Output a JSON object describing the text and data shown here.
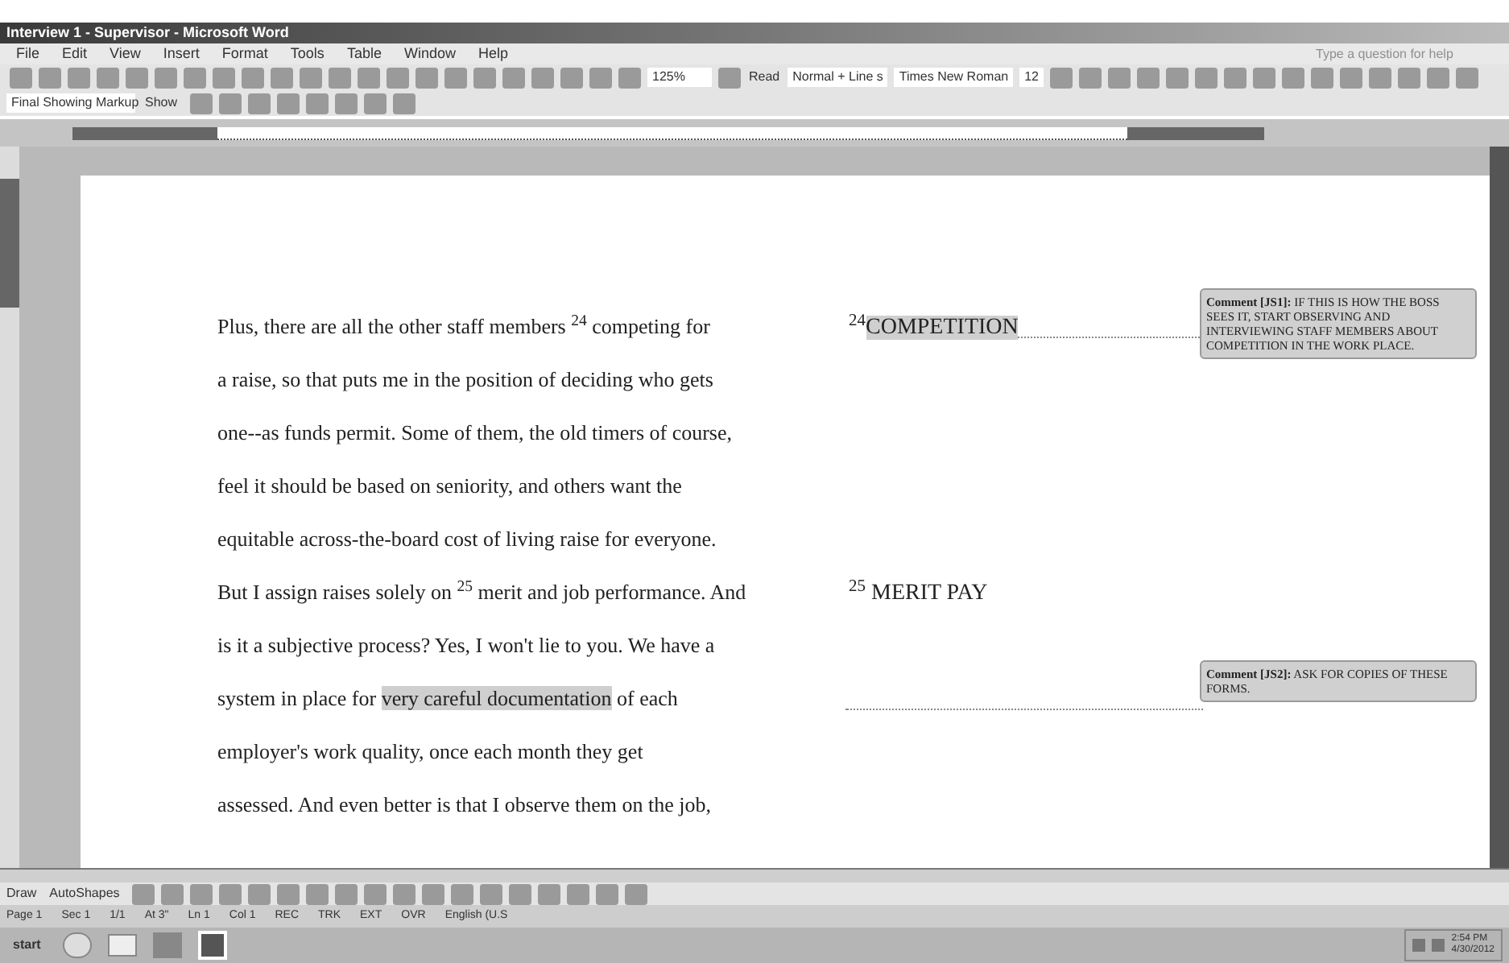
{
  "window": {
    "title": "Interview 1 - Supervisor - Microsoft Word"
  },
  "menu": [
    "File",
    "Edit",
    "View",
    "Insert",
    "Format",
    "Tools",
    "Table",
    "Window",
    "Help"
  ],
  "help_box": {
    "placeholder": "Type a question for help"
  },
  "toolbar": {
    "zoom": "125%",
    "read": "Read",
    "style": "Normal + Line s",
    "font": "Times New Roman",
    "size": "12"
  },
  "reviewing": {
    "display": "Final Showing Markup",
    "show": "Show"
  },
  "drawing_toolbar": {
    "draw": "Draw",
    "autoshapes": "AutoShapes"
  },
  "document": {
    "lines": [
      {
        "parts": [
          {
            "kind": "plain",
            "text": "Plus, there are all the other staff members $^{24}$ competing for"
          }
        ],
        "note": [
          {
            "kind": "plain",
            "text": "$^{24}$"
          },
          {
            "kind": "highlight",
            "text": "COMPETITION"
          }
        ],
        "comment": {
          "label": "Comment [JS1]:",
          "text": "IF THIS IS HOW THE BOSS SEES IT, START OBSERVING AND INTERVIEWING STAFF MEMBERS ABOUT COMPETITION IN THE WORK PLACE."
        }
      },
      {
        "parts": [
          {
            "kind": "plain",
            "text": "a raise, so that puts me in the position of deciding who gets"
          }
        ]
      },
      {
        "parts": [
          {
            "kind": "plain",
            "text": "one--as funds permit. Some of them, the old timers of course,"
          }
        ]
      },
      {
        "parts": [
          {
            "kind": "plain",
            "text": "feel it should be based on seniority, and others want the"
          }
        ]
      },
      {
        "parts": [
          {
            "kind": "plain",
            "text": "equitable across-the-board cost of living raise for everyone."
          }
        ]
      },
      {
        "parts": [
          {
            "kind": "plain",
            "text": "But I assign raises solely on $^{25}$ merit and job performance. And"
          }
        ],
        "note": [
          {
            "kind": "plain",
            "text": "$^{25}$ MERIT PAY"
          }
        ]
      },
      {
        "parts": [
          {
            "kind": "plain",
            "text": "is it a subjective process? Yes, I won't lie to you. We have a"
          }
        ]
      },
      {
        "parts": [
          {
            "kind": "plain",
            "text": "system in place for "
          },
          {
            "kind": "highlight",
            "text": "very careful documentation"
          },
          {
            "kind": "plain",
            "text": " of each"
          }
        ],
        "comment": {
          "label": "Comment [JS2]:",
          "text": "ASK FOR COPIES OF THESE FORMS."
        }
      },
      {
        "parts": [
          {
            "kind": "plain",
            "text": "employer's work quality, once each month they get"
          }
        ]
      },
      {
        "parts": [
          {
            "kind": "plain",
            "text": "assessed. And even better is that I observe them on the job,"
          }
        ]
      }
    ]
  },
  "status_bar": [
    "Page 1",
    "Sec 1",
    "1/1",
    "At 3\"",
    "Ln 1",
    "Col 1",
    "REC",
    "TRK",
    "EXT",
    "OVR",
    "English (U.S"
  ],
  "taskbar": {
    "start": "start",
    "time": "2:54 PM",
    "date": "4/30/2012"
  }
}
